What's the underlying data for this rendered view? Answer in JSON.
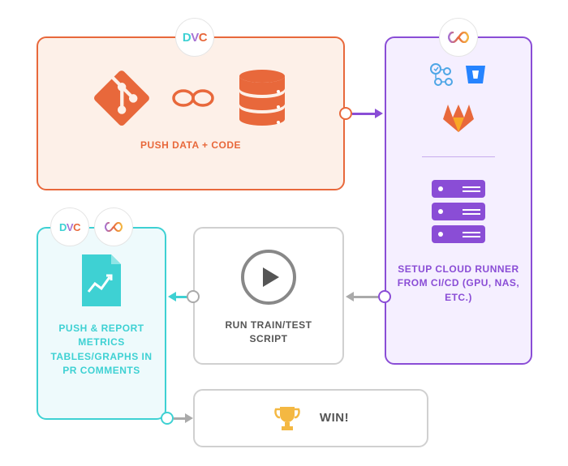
{
  "cards": {
    "push": {
      "label": "PUSH DATA + CODE"
    },
    "runner": {
      "label": "SETUP CLOUD RUNNER FROM CI/CD (GPU, NAS, ETC.)"
    },
    "run": {
      "label": "RUN TRAIN/TEST SCRIPT"
    },
    "metrics": {
      "label": "PUSH & REPORT METRICS TABLES/GRAPHS IN PR COMMENTS"
    },
    "win": {
      "label": "WIN!"
    }
  },
  "badges": {
    "dvc": "DVC",
    "cml": "∞"
  },
  "colors": {
    "orange": "#e8683b",
    "purple": "#8a4dd6",
    "teal": "#3ed1d3",
    "gray": "#d0d0d0"
  }
}
